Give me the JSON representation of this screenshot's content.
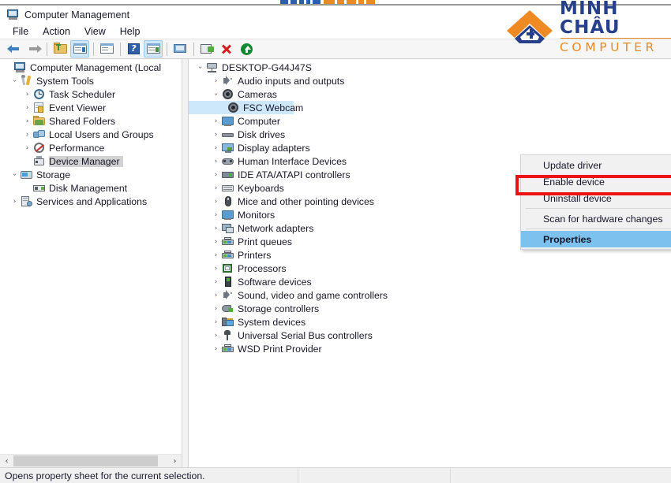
{
  "window": {
    "title": "Computer Management",
    "title_icon": "computer-management-icon"
  },
  "brand": {
    "line1": "MINH CHÂU",
    "line2": "COMPUTER",
    "mark_icon": "minh-chau-logo-mark",
    "color_orange": "#e98a25",
    "color_blue": "#27408b"
  },
  "menubar": {
    "items": [
      {
        "label": "File"
      },
      {
        "label": "Action"
      },
      {
        "label": "View"
      },
      {
        "label": "Help"
      }
    ]
  },
  "toolbar": {
    "buttons": [
      {
        "name": "back-button",
        "icon": "arrow-left-icon",
        "pressed": false
      },
      {
        "name": "forward-button",
        "icon": "arrow-right-icon",
        "pressed": false
      },
      {
        "name": "up-one-level-button",
        "icon": "folder-up-icon",
        "pressed": false
      },
      {
        "name": "show-hide-console-tree-button",
        "icon": "console-tree-icon",
        "pressed": true
      },
      {
        "name": "properties-button",
        "icon": "properties-window-icon",
        "pressed": false
      },
      {
        "name": "help-button",
        "icon": "question-mark-icon",
        "pressed": false
      },
      {
        "name": "show-hide-action-pane-button",
        "icon": "action-pane-icon",
        "pressed": true
      },
      {
        "name": "remote-connect-button",
        "icon": "monitor-icon",
        "pressed": false
      },
      {
        "name": "update-driver-button",
        "icon": "driver-update-icon",
        "pressed": false
      },
      {
        "name": "uninstall-device-button",
        "icon": "red-x-icon",
        "pressed": false
      },
      {
        "name": "enable-device-button",
        "icon": "green-up-arrow-icon",
        "pressed": false
      }
    ]
  },
  "console_tree": {
    "items": [
      {
        "label": "Computer Management (Local",
        "depth": 0,
        "twisty": "none",
        "icon": "computer-management-icon",
        "selected": false
      },
      {
        "label": "System Tools",
        "depth": 1,
        "twisty": "expanded",
        "icon": "system-tools-icon",
        "selected": false
      },
      {
        "label": "Task Scheduler",
        "depth": 2,
        "twisty": "collapsed",
        "icon": "clock-icon",
        "selected": false
      },
      {
        "label": "Event Viewer",
        "depth": 2,
        "twisty": "collapsed",
        "icon": "event-viewer-icon",
        "selected": false
      },
      {
        "label": "Shared Folders",
        "depth": 2,
        "twisty": "collapsed",
        "icon": "shared-folders-icon",
        "selected": false
      },
      {
        "label": "Local Users and Groups",
        "depth": 2,
        "twisty": "collapsed",
        "icon": "users-groups-icon",
        "selected": false
      },
      {
        "label": "Performance",
        "depth": 2,
        "twisty": "collapsed",
        "icon": "performance-icon",
        "selected": false
      },
      {
        "label": "Device Manager",
        "depth": 2,
        "twisty": "none",
        "icon": "device-manager-icon",
        "selected": true
      },
      {
        "label": "Storage",
        "depth": 1,
        "twisty": "expanded",
        "icon": "storage-icon",
        "selected": false
      },
      {
        "label": "Disk Management",
        "depth": 2,
        "twisty": "none",
        "icon": "disk-management-icon",
        "selected": false
      },
      {
        "label": "Services and Applications",
        "depth": 1,
        "twisty": "collapsed",
        "icon": "services-icon",
        "selected": false
      }
    ],
    "hscroll": {
      "left_arrow": "‹",
      "right_arrow": "›"
    }
  },
  "device_tree": {
    "items": [
      {
        "label": "DESKTOP-G44J47S",
        "depth": 0,
        "twisty": "expanded",
        "icon": "computer-root-icon",
        "selected": false
      },
      {
        "label": "Audio inputs and outputs",
        "depth": 1,
        "twisty": "collapsed",
        "icon": "speaker-icon",
        "selected": false
      },
      {
        "label": "Cameras",
        "depth": 1,
        "twisty": "expanded",
        "icon": "camera-icon",
        "selected": false
      },
      {
        "label": "FSC Webcam",
        "depth": 2,
        "twisty": "none",
        "icon": "camera-icon",
        "selected": true
      },
      {
        "label": "Computer",
        "depth": 1,
        "twisty": "collapsed",
        "icon": "monitor-icon",
        "selected": false
      },
      {
        "label": "Disk drives",
        "depth": 1,
        "twisty": "collapsed",
        "icon": "disk-drive-icon",
        "selected": false
      },
      {
        "label": "Display adapters",
        "depth": 1,
        "twisty": "collapsed",
        "icon": "display-adapter-icon",
        "selected": false
      },
      {
        "label": "Human Interface Devices",
        "depth": 1,
        "twisty": "collapsed",
        "icon": "hid-gamepad-icon",
        "selected": false
      },
      {
        "label": "IDE ATA/ATAPI controllers",
        "depth": 1,
        "twisty": "collapsed",
        "icon": "ide-controller-icon",
        "selected": false
      },
      {
        "label": "Keyboards",
        "depth": 1,
        "twisty": "collapsed",
        "icon": "keyboard-icon",
        "selected": false
      },
      {
        "label": "Mice and other pointing devices",
        "depth": 1,
        "twisty": "collapsed",
        "icon": "mouse-icon",
        "selected": false
      },
      {
        "label": "Monitors",
        "depth": 1,
        "twisty": "collapsed",
        "icon": "monitor-icon",
        "selected": false
      },
      {
        "label": "Network adapters",
        "depth": 1,
        "twisty": "collapsed",
        "icon": "network-adapter-icon",
        "selected": false
      },
      {
        "label": "Print queues",
        "depth": 1,
        "twisty": "collapsed",
        "icon": "printer-icon",
        "selected": false
      },
      {
        "label": "Printers",
        "depth": 1,
        "twisty": "collapsed",
        "icon": "printer-icon",
        "selected": false
      },
      {
        "label": "Processors",
        "depth": 1,
        "twisty": "collapsed",
        "icon": "processor-icon",
        "selected": false
      },
      {
        "label": "Software devices",
        "depth": 1,
        "twisty": "collapsed",
        "icon": "software-device-icon",
        "selected": false
      },
      {
        "label": "Sound, video and game controllers",
        "depth": 1,
        "twisty": "collapsed",
        "icon": "speaker-icon",
        "selected": false
      },
      {
        "label": "Storage controllers",
        "depth": 1,
        "twisty": "collapsed",
        "icon": "storage-controller-icon",
        "selected": false
      },
      {
        "label": "System devices",
        "depth": 1,
        "twisty": "collapsed",
        "icon": "system-device-icon",
        "selected": false
      },
      {
        "label": "Universal Serial Bus controllers",
        "depth": 1,
        "twisty": "collapsed",
        "icon": "usb-icon",
        "selected": false
      },
      {
        "label": "WSD Print Provider",
        "depth": 1,
        "twisty": "collapsed",
        "icon": "printer-icon",
        "selected": false
      }
    ]
  },
  "context_menu": {
    "items": [
      {
        "label": "Update driver",
        "highlight": false,
        "sep_after": false
      },
      {
        "label": "Enable device",
        "highlight": false,
        "sep_after": false
      },
      {
        "label": "Uninstall device",
        "highlight": false,
        "sep_after": true
      },
      {
        "label": "Scan for hardware changes",
        "highlight": false,
        "sep_after": true
      },
      {
        "label": "Properties",
        "highlight": true,
        "sep_after": false
      }
    ],
    "highlight_color": "#7dc2ef",
    "annotation": {
      "target_label": "Enable device",
      "box_color": "#ee1111"
    }
  },
  "statusbar": {
    "text": "Opens property sheet for the current selection."
  }
}
